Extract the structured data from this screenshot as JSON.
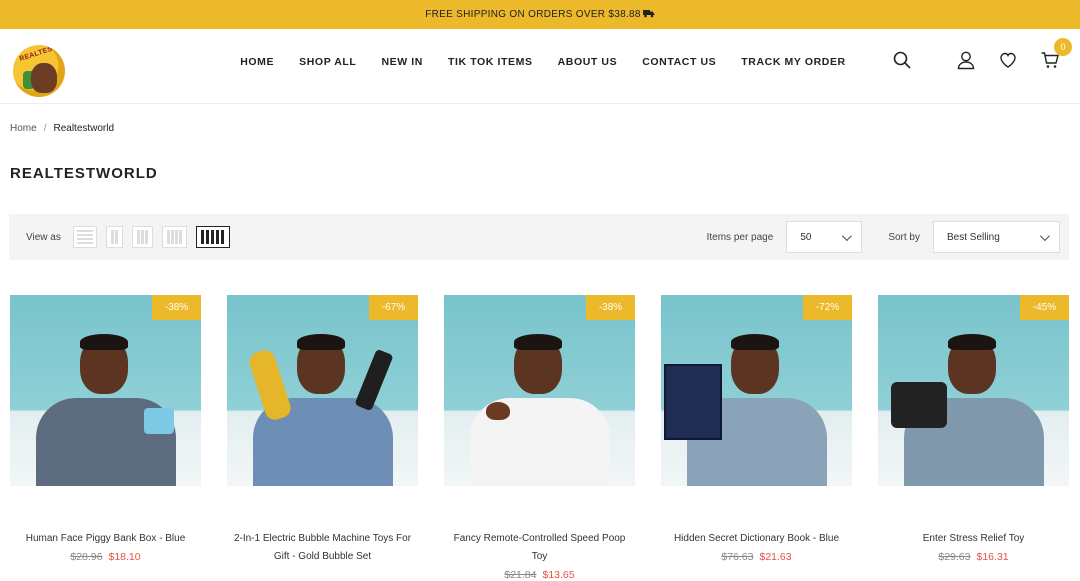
{
  "announcement": {
    "text": "FREE SHIPPING ON ORDERS OVER $38.88",
    "icon": "truck-icon"
  },
  "header": {
    "logo_text": "REALTEST",
    "nav": [
      "HOME",
      "SHOP ALL",
      "NEW IN",
      "TIK TOK ITEMS",
      "ABOUT US",
      "CONTACT US",
      "TRACK MY ORDER"
    ],
    "icons": [
      "search-icon",
      "user-icon",
      "heart-icon",
      "cart-icon"
    ],
    "cart_count": "0"
  },
  "breadcrumb": {
    "home": "Home",
    "separator": "/",
    "current": "Realtestworld"
  },
  "page_title": "REALTESTWORLD",
  "toolbar": {
    "view_as_label": "View as",
    "active_view": "5 columns",
    "items_per_page_label": "Items per page",
    "items_per_page_value": "50",
    "sort_by_label": "Sort by",
    "sort_by_value": "Best Selling"
  },
  "products": [
    {
      "title": "Human Face Piggy Bank Box - Blue",
      "old_price": "$28.96",
      "new_price": "$18.10",
      "badge": "-38%",
      "shirt": "#5c6b7e",
      "prop": "#7cc9e6"
    },
    {
      "title": "2-In-1 Electric Bubble Machine Toys For Gift - Gold Bubble Set",
      "old_price": "",
      "new_price": "",
      "badge": "-67%",
      "shirt": "#6e8fb5",
      "prop": "#e5b52a"
    },
    {
      "title": "Fancy Remote-Controlled Speed Poop Toy",
      "old_price": "$21.84",
      "new_price": "$13.65",
      "badge": "-38%",
      "shirt": "#f4f4f4",
      "prop": "#6a3b22"
    },
    {
      "title": "Hidden Secret Dictionary Book - Blue",
      "old_price": "$76.63",
      "new_price": "$21.63",
      "badge": "-72%",
      "shirt": "#8aa3b8",
      "prop": "#1f2d55"
    },
    {
      "title": "Enter Stress Relief Toy",
      "old_price": "$29.63",
      "new_price": "$16.31",
      "badge": "-45%",
      "shirt": "#7f98ac",
      "prop": "#222"
    }
  ],
  "colors": {
    "accent": "#ecb92a",
    "sale_price": "#e95144",
    "toolbar_bg": "#f4f4f4"
  }
}
